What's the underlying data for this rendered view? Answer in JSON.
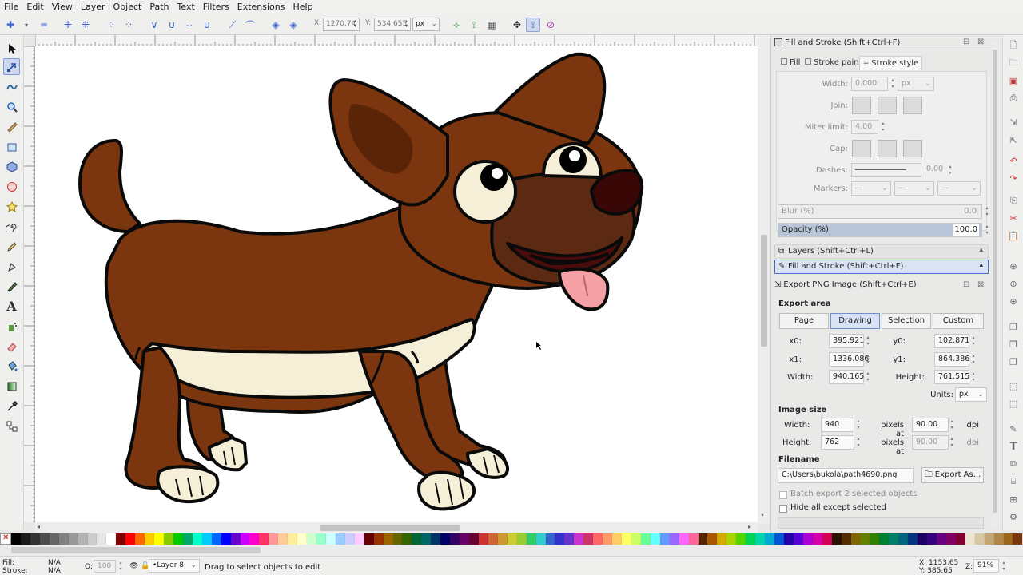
{
  "menu": [
    "File",
    "Edit",
    "View",
    "Layer",
    "Object",
    "Path",
    "Text",
    "Filters",
    "Extensions",
    "Help"
  ],
  "toolctrl": {
    "x_label": "X:",
    "x_value": "1270.74",
    "y_label": "Y:",
    "y_value": "534.655",
    "unit": "px"
  },
  "fill_stroke": {
    "title": "Fill and Stroke (Shift+Ctrl+F)",
    "tabs": [
      "Fill",
      "Stroke paint",
      "Stroke style"
    ],
    "width_label": "Width:",
    "width_value": "0.000",
    "width_unit": "px",
    "join_label": "Join:",
    "miter_label": "Miter limit:",
    "miter_value": "4.00",
    "cap_label": "Cap:",
    "dashes_label": "Dashes:",
    "dashes_value": "0.00",
    "markers_label": "Markers:",
    "blur_label": "Blur (%)",
    "blur_value": "0.0",
    "opacity_label": "Opacity (%)",
    "opacity_value": "100.0"
  },
  "collapsed": {
    "layers": "Layers (Shift+Ctrl+L)",
    "fill_stroke": "Fill and Stroke (Shift+Ctrl+F)"
  },
  "export": {
    "title": "Export PNG Image (Shift+Ctrl+E)",
    "area_label": "Export area",
    "area_buttons": [
      "Page",
      "Drawing",
      "Selection",
      "Custom"
    ],
    "x0_label": "x0:",
    "x0": "395.921",
    "y0_label": "y0:",
    "y0": "102.871",
    "x1_label": "x1:",
    "x1": "1336.086",
    "y1_label": "y1:",
    "y1": "864.386",
    "width_label": "Width:",
    "width": "940.165",
    "height_label": "Height:",
    "height": "761.515",
    "units_label": "Units:",
    "units": "px",
    "image_size_label": "Image size",
    "img_width_label": "Width:",
    "img_width": "940",
    "img_height_label": "Height:",
    "img_height": "762",
    "pixels_at": "pixels at",
    "dpi_value": "90.00",
    "dpi_value2": "90.00",
    "dpi": "dpi",
    "filename_label": "Filename",
    "filename": "C:\\Users\\bukola\\path4690.png",
    "export_as": "Export As...",
    "batch_label": "Batch export 2 selected objects",
    "hide_label": "Hide all except selected"
  },
  "status": {
    "fill_label": "Fill:",
    "fill_value": "N/A",
    "stroke_label": "Stroke:",
    "stroke_value": "N/A",
    "opacity_label": "O:",
    "opacity_value": "100",
    "layer": "Layer 8",
    "message": "Drag to select objects to edit",
    "coord_x": "X: 1153.65",
    "coord_y": "Y: 385.65",
    "zoom_label": "Z:",
    "zoom": "91%"
  },
  "colors": {
    "accent": "#6f8fd0",
    "dog_brown": "#7b3610",
    "dog_cream": "#f6efd8",
    "nose": "#3a0707",
    "tongue": "#f4a0a4"
  },
  "palette": [
    "#000000",
    "#1a1a1a",
    "#333333",
    "#4d4d4d",
    "#666666",
    "#808080",
    "#999999",
    "#b3b3b3",
    "#cccccc",
    "#e6e6e6",
    "#ffffff",
    "#800000",
    "#ff0000",
    "#ff6600",
    "#ffcc00",
    "#ffff00",
    "#88cc00",
    "#00cc00",
    "#00aa66",
    "#00ffcc",
    "#00ccff",
    "#0066ff",
    "#0000ff",
    "#6600cc",
    "#cc00ff",
    "#ff00cc",
    "#ff3366",
    "#ff9999",
    "#ffcc99",
    "#ffee99",
    "#ffffcc",
    "#ccffcc",
    "#99ffcc",
    "#ccffff",
    "#99ccff",
    "#ccccff",
    "#ffccff",
    "#660000",
    "#993300",
    "#996600",
    "#666600",
    "#336600",
    "#006633",
    "#006666",
    "#003366",
    "#000066",
    "#330066",
    "#660066",
    "#660033",
    "#cc3333",
    "#cc6633",
    "#cc9933",
    "#cccc33",
    "#99cc33",
    "#33cc66",
    "#33cccc",
    "#3366cc",
    "#3333cc",
    "#6633cc",
    "#cc33cc",
    "#cc3366",
    "#ff6666",
    "#ff9966",
    "#ffcc66",
    "#ffff66",
    "#ccff66",
    "#66ff99",
    "#66ffff",
    "#6699ff",
    "#9966ff",
    "#ff66ff",
    "#ff6699",
    "#552200",
    "#aa5500",
    "#d4aa00",
    "#aad400",
    "#55d400",
    "#00d455",
    "#00d4aa",
    "#00aad4",
    "#0055d4",
    "#2200aa",
    "#5500d4",
    "#aa00d4",
    "#d400aa",
    "#d40055",
    "#2b1100",
    "#552b00",
    "#806600",
    "#668000",
    "#338000",
    "#008033",
    "#008066",
    "#006680",
    "#003380",
    "#1a0066",
    "#330080",
    "#660080",
    "#800066",
    "#800033",
    "#ece5d0",
    "#d8c7a3",
    "#c4a676",
    "#b08649",
    "#9c661c",
    "#7b3610"
  ]
}
